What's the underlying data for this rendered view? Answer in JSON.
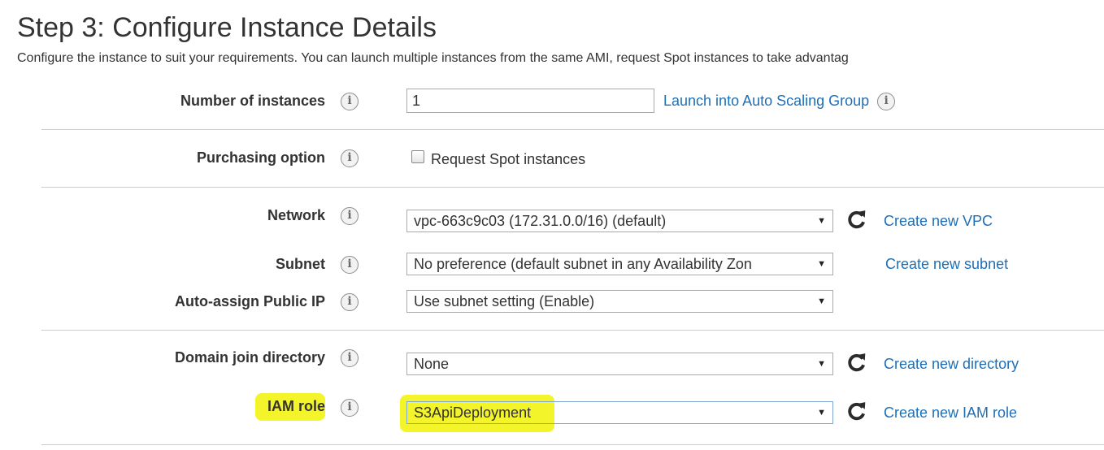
{
  "page": {
    "title": "Step 3: Configure Instance Details",
    "subtitle": "Configure the instance to suit your requirements. You can launch multiple instances from the same AMI, request Spot instances to take advantag"
  },
  "info_glyph": "i",
  "number_of_instances": {
    "label": "Number of instances",
    "value": "1",
    "link": "Launch into Auto Scaling Group"
  },
  "purchasing_option": {
    "label": "Purchasing option",
    "checkbox_label": "Request Spot instances",
    "checked": false
  },
  "network": {
    "label": "Network",
    "selected": "vpc-663c9c03 (172.31.0.0/16) (default)",
    "link": "Create new VPC"
  },
  "subnet": {
    "label": "Subnet",
    "selected": "No preference (default subnet in any Availability Zon",
    "link": "Create new subnet"
  },
  "auto_assign_public_ip": {
    "label": "Auto-assign Public IP",
    "selected": "Use subnet setting (Enable)"
  },
  "domain_join_directory": {
    "label": "Domain join directory",
    "selected": "None",
    "link": "Create new directory"
  },
  "iam_role": {
    "label": "IAM role",
    "selected": "S3ApiDeployment",
    "link": "Create new IAM role"
  },
  "select_arrow": "▼",
  "colors": {
    "link": "#1d6fb8",
    "highlight": "#f4f42a",
    "divider": "#cccccc",
    "text": "#333333"
  }
}
